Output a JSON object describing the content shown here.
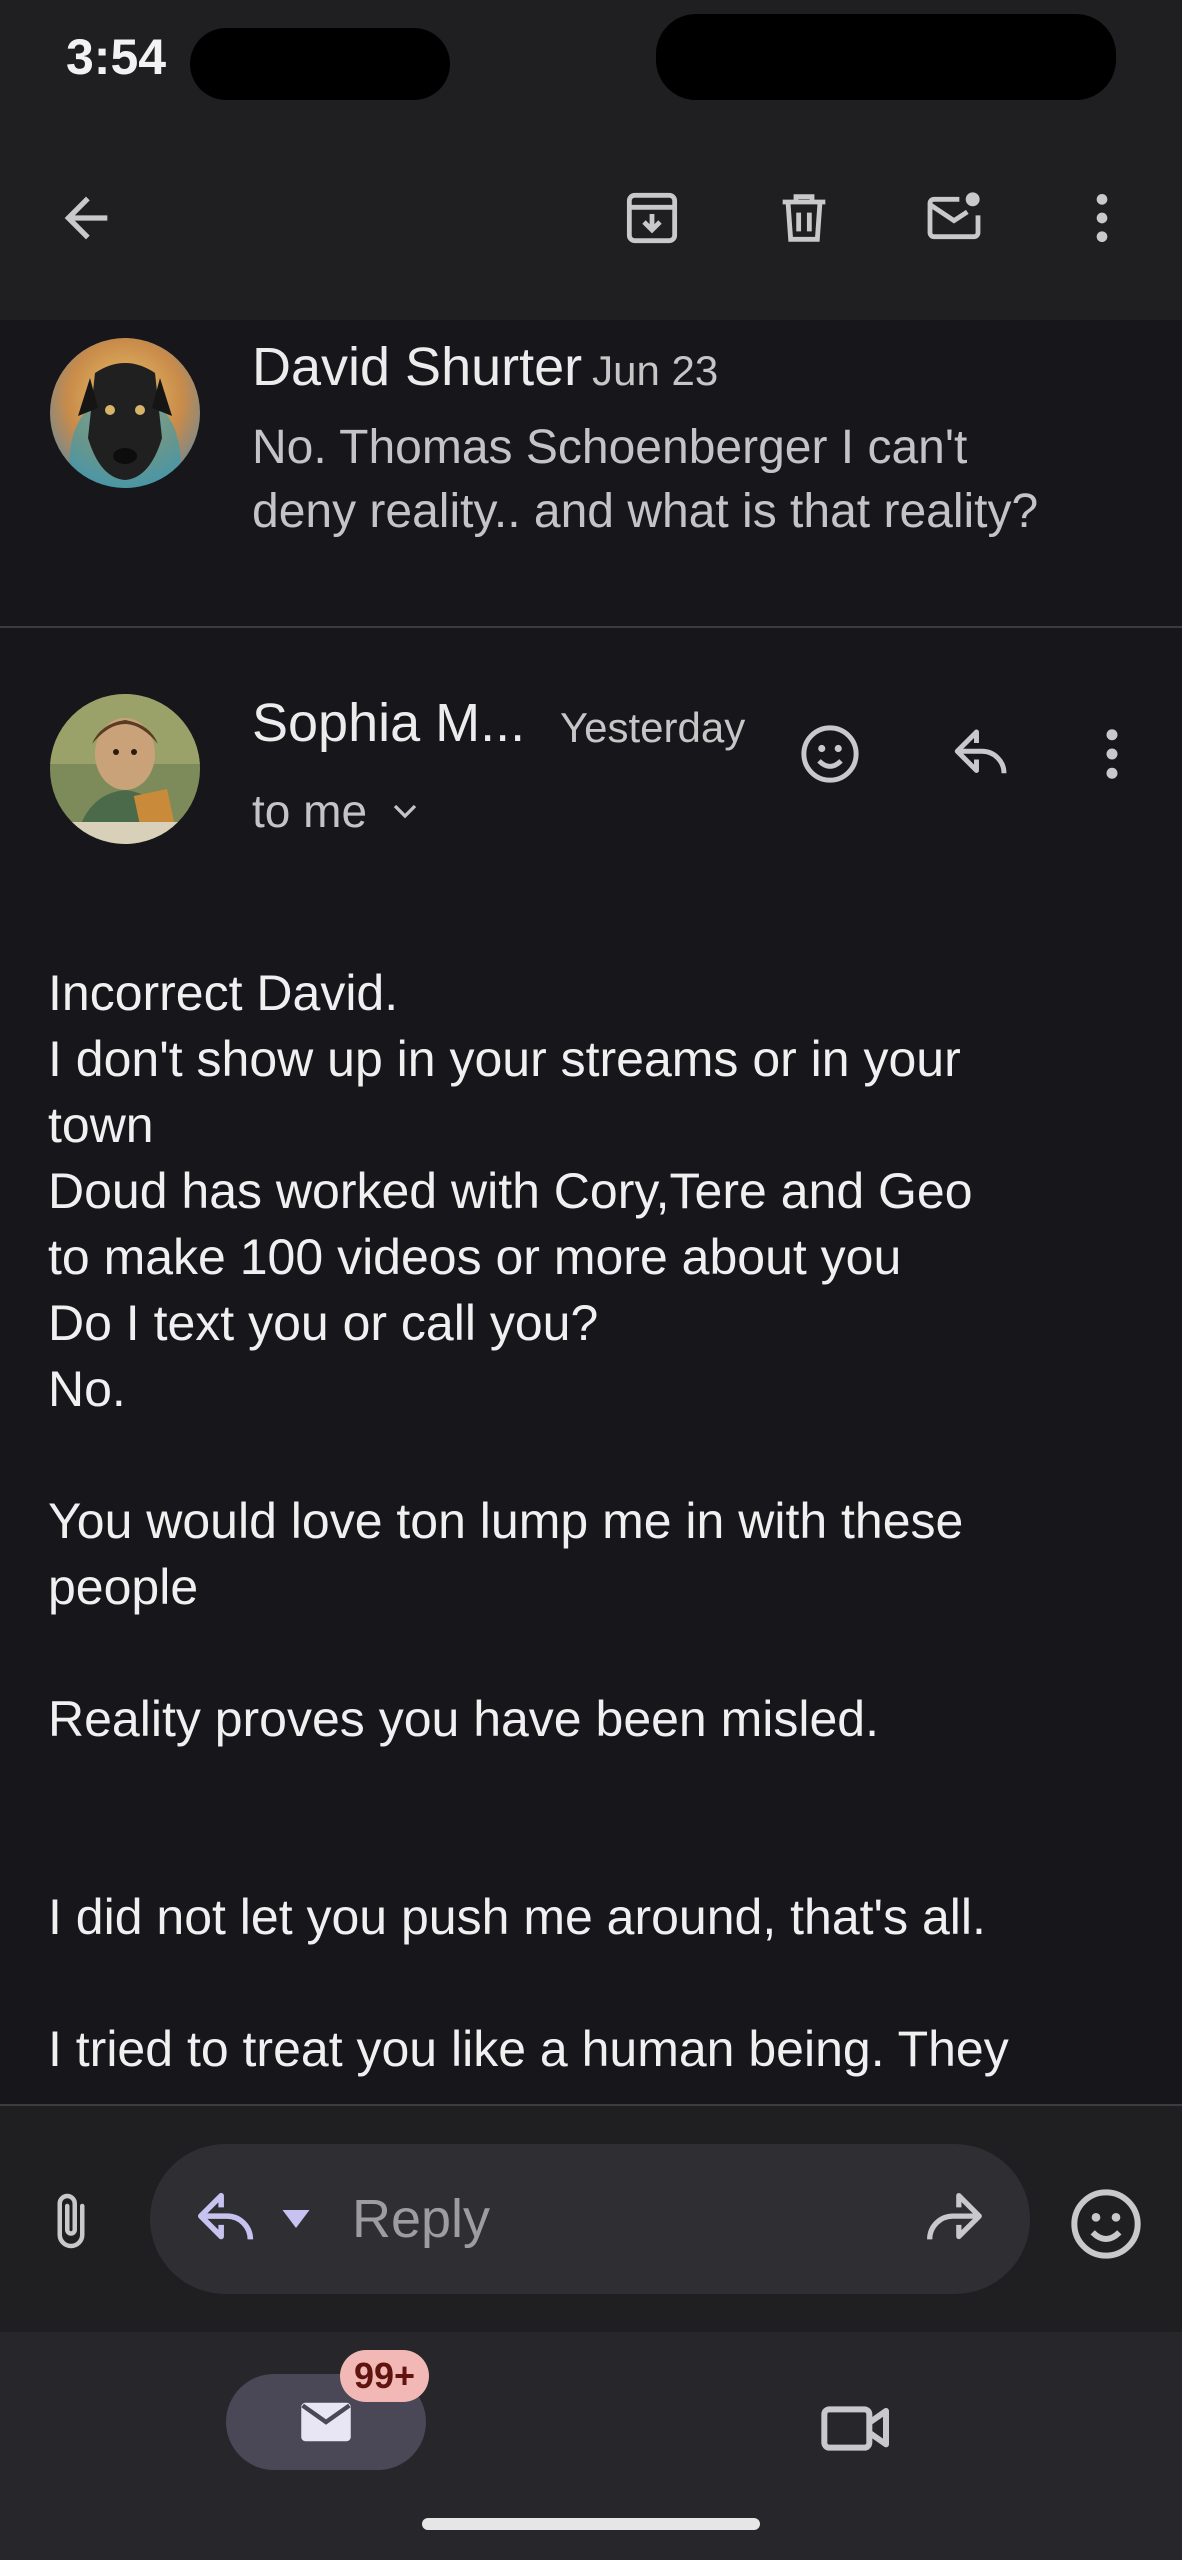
{
  "status_bar": {
    "time": "3:54"
  },
  "toolbar": {
    "back_icon": "arrow-left-icon",
    "archive_icon": "archive-icon",
    "delete_icon": "trash-icon",
    "mark_unread_icon": "mark-unread-icon",
    "more_icon": "more-vert-icon"
  },
  "messages": [
    {
      "sender": "David Shurter",
      "date": "Jun 23",
      "snippet_lines": [
        "No. Thomas Schoenberger I can't",
        "deny reality.. and what is that reality?"
      ]
    },
    {
      "sender": "Sophia M...",
      "date": "Yesterday",
      "recipient": "to me",
      "body_lines": [
        "Incorrect David.",
        "I don't show up in your streams or in your",
        "town",
        "Doud has worked with Cory,Tere and Geo",
        "to make 100 videos or more about you",
        "Do I text you or call you?",
        "No.",
        "",
        "You would love ton lump me in with these",
        "people",
        "",
        "Reality proves you have been misled.",
        "",
        "",
        "I did not let you push me around, that's all.",
        "",
        "I tried to treat you like a human being. They"
      ]
    }
  ],
  "reply_bar": {
    "placeholder": "Reply"
  },
  "bottom_nav": {
    "mail_badge": "99+"
  },
  "colors": {
    "background": "#17171b",
    "toolbar": "#1f1f21",
    "reply_pill": "#2e2e33",
    "accent_lavender": "#c8c2f0",
    "badge": "#f2b8b5"
  }
}
